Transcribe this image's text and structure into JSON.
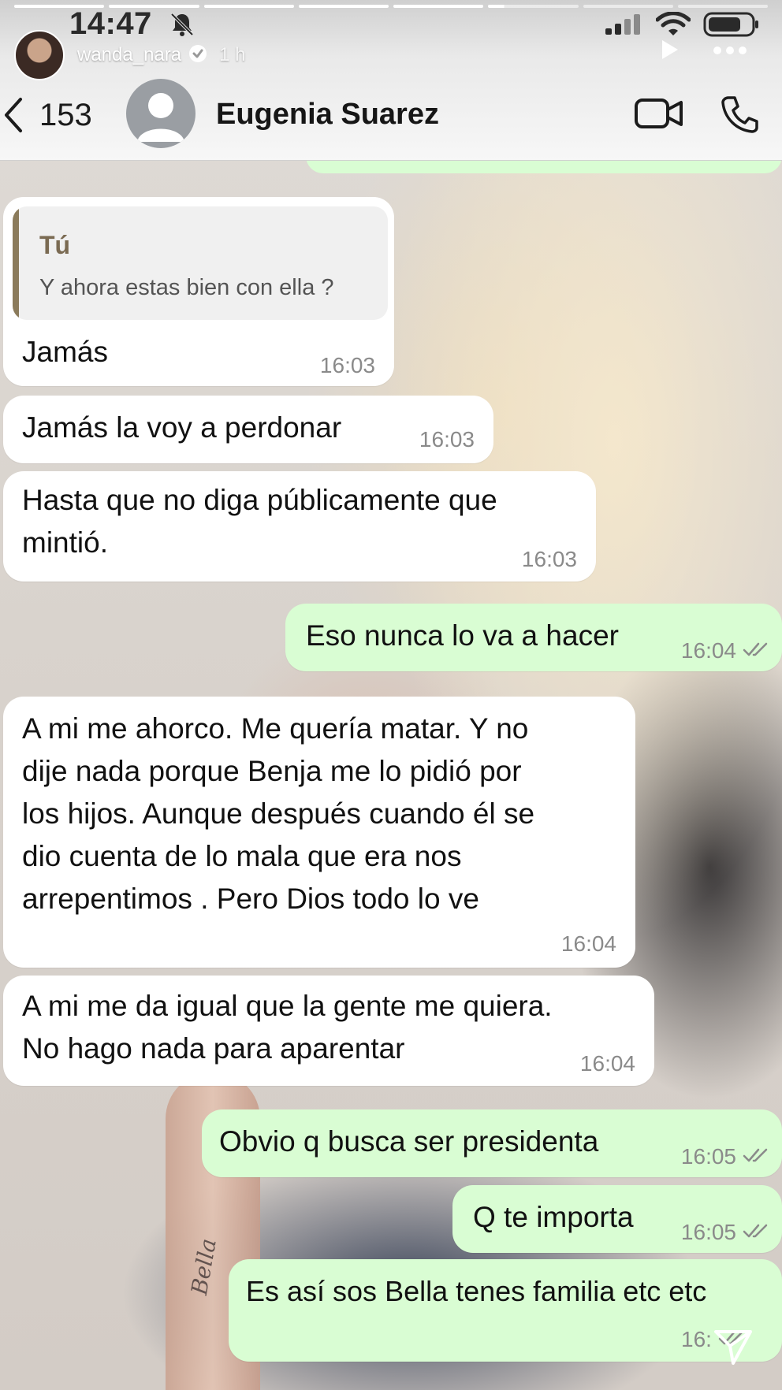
{
  "story": {
    "time": "14:47",
    "username": "wanda_nara",
    "posted_ago": "1 h",
    "progress_segments": 8,
    "active_segment": 5,
    "active_progress": 0.18
  },
  "chat": {
    "unread_count": "153",
    "contact_name": "Eugenia Suarez"
  },
  "icons": {
    "back": "chevron-left-icon",
    "contact_avatar": "person-icon",
    "video": "video-call-icon",
    "phone": "phone-icon",
    "mute": "bell-slash-icon",
    "signal": "signal-icon",
    "wifi": "wifi-icon",
    "battery": "battery-icon",
    "play": "play-icon",
    "more": "more-icon",
    "send": "send-icon",
    "verified": "verified-badge-icon"
  },
  "colors": {
    "incoming_bubble": "#ffffff",
    "outgoing_bubble": "#d9fdd3",
    "timestamp": "#8a8a8a"
  },
  "messages": [
    {
      "direction": "incoming",
      "reply_to": {
        "author": "Tú",
        "text": "Y ahora estas bien con ella ?"
      },
      "text": "Jamás",
      "time": "16:03"
    },
    {
      "direction": "incoming",
      "text": "Jamás la voy a perdonar",
      "time": "16:03"
    },
    {
      "direction": "incoming",
      "text": "Hasta que no diga públicamente que\nmintió.",
      "time": "16:03"
    },
    {
      "direction": "outgoing",
      "text": "Eso nunca lo va a hacer",
      "time": "16:04",
      "read": true
    },
    {
      "direction": "incoming",
      "text": "A mi me ahorco. Me quería matar. Y no\ndije nada porque Benja me lo pidió por\nlos hijos. Aunque después cuando él se\ndio cuenta de lo mala que era nos\narrepentimos . Pero Dios todo lo ve",
      "time": "16:04"
    },
    {
      "direction": "incoming",
      "text": "A mi me da igual que la gente me quiera.\nNo hago nada para aparentar",
      "time": "16:04"
    },
    {
      "direction": "outgoing",
      "text": "Obvio q busca ser presidenta",
      "time": "16:05",
      "read": true
    },
    {
      "direction": "outgoing",
      "text": "Q te importa",
      "time": "16:05",
      "read": true
    },
    {
      "direction": "outgoing",
      "text": "Es así sos Bella tenes familia etc etc",
      "time": "16:",
      "read": true
    }
  ],
  "background": {
    "tattoo_text": "Bella"
  }
}
